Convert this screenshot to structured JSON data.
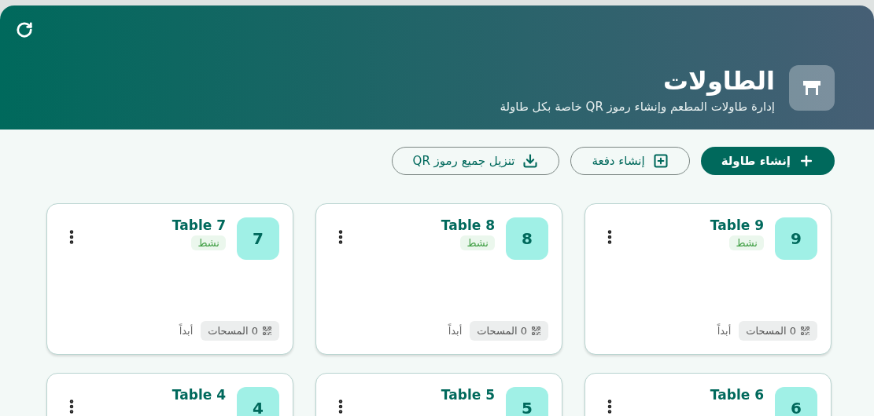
{
  "header": {
    "title": "الطاولات",
    "subtitle": "إدارة طاولات المطعم وإنشاء رموز QR خاصة بكل طاولة"
  },
  "actions": [
    {
      "kind": "primary",
      "label": "إنشاء طاولة"
    },
    {
      "kind": "batch",
      "label": "إنشاء دفعة"
    },
    {
      "kind": "download",
      "label": "تنزيل جميع رموز QR"
    }
  ],
  "tables": [
    {
      "number": "9",
      "name": "Table 9",
      "status": "نشط",
      "scans": "0 المسحات",
      "last_scan": "أبداً"
    },
    {
      "number": "8",
      "name": "Table 8",
      "status": "نشط",
      "scans": "0 المسحات",
      "last_scan": "أبداً"
    },
    {
      "number": "7",
      "name": "Table 7",
      "status": "نشط",
      "scans": "0 المسحات",
      "last_scan": "أبداً"
    },
    {
      "number": "6",
      "name": "Table 6"
    },
    {
      "number": "5",
      "name": "Table 5"
    },
    {
      "number": "4",
      "name": "Table 4"
    }
  ]
}
